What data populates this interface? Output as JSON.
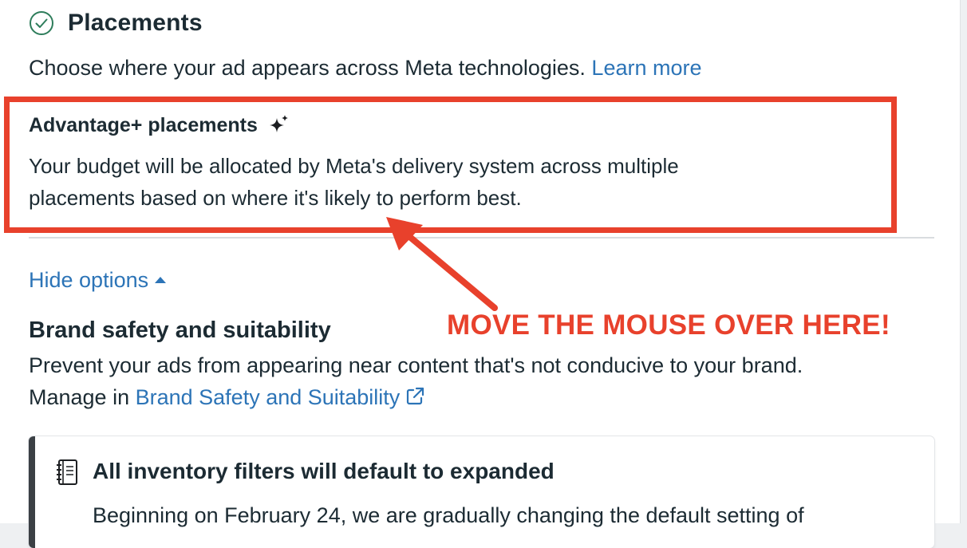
{
  "placements": {
    "title": "Placements",
    "description": "Choose where your ad appears across Meta technologies.",
    "learn_more": "Learn more"
  },
  "advantage": {
    "title": "Advantage+ placements",
    "description_line1": "Your budget will be allocated by Meta's delivery system across multiple",
    "description_line2": "placements based on where it's likely to perform best."
  },
  "options": {
    "hide_label": "Hide options"
  },
  "brand_safety": {
    "title": "Brand safety and suitability",
    "description": "Prevent your ads from appearing near content that's not conducive to your brand.",
    "manage_prefix": "Manage in",
    "manage_link": "Brand Safety and Suitability"
  },
  "annotation": {
    "text": "MOVE THE MOUSE OVER HERE!"
  },
  "notice": {
    "title": "All inventory filters will default to expanded",
    "body": "Beginning on February 24, we are gradually changing the default setting of"
  },
  "icons": {
    "header": "check-circle-icon",
    "advantage": "sparkle-icon",
    "hide": "caret-up-icon",
    "external": "external-link-icon",
    "notice": "notebook-icon"
  },
  "colors": {
    "accent_link": "#2c74b7",
    "annotation_red": "#e8412c",
    "success_green": "#2e7d5b"
  }
}
